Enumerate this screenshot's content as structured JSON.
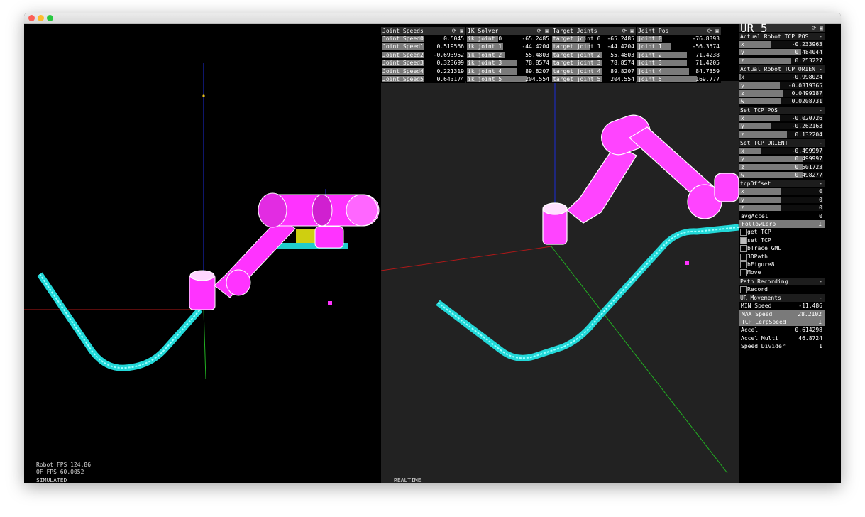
{
  "window": {
    "controls": [
      "close",
      "minimize",
      "zoom"
    ]
  },
  "left_view": {
    "robot_fps": "Robot FPS 124.86",
    "of_fps": "OF FPS 60.0052",
    "mode": "SIMULATED"
  },
  "right_view": {
    "mode": "REALTIME"
  },
  "panels": [
    {
      "title": "Joint Speeds",
      "rows": [
        {
          "label": "Joint Speed0",
          "value": "0.5045",
          "fill": 0.5
        },
        {
          "label": "Joint Speed1",
          "value": "0.519566",
          "fill": 0.5
        },
        {
          "label": "Joint Speed2",
          "value": "-0.693952",
          "fill": 0.5
        },
        {
          "label": "Joint Speed3",
          "value": "0.323699",
          "fill": 0.5
        },
        {
          "label": "Joint Speed4",
          "value": "0.221319",
          "fill": 0.5
        },
        {
          "label": "Joint Speed5",
          "value": "0.643174",
          "fill": 0.5
        }
      ]
    },
    {
      "title": "IK Solver",
      "rows": [
        {
          "label": "ik joint 0",
          "value": "-65.2485",
          "fill": 0.38
        },
        {
          "label": "ik joint 1",
          "value": "-44.4204",
          "fill": 0.44
        },
        {
          "label": "ik joint 2",
          "value": "55.4803",
          "fill": 0.45
        },
        {
          "label": "ik joint 3",
          "value": "78.8574",
          "fill": 0.6
        },
        {
          "label": "ik joint 4",
          "value": "89.8207",
          "fill": 0.6
        },
        {
          "label": "ik joint 5",
          "value": "204.554",
          "fill": 0.72
        }
      ]
    },
    {
      "title": "Target Joints",
      "rows": [
        {
          "label": "target joint 0",
          "value": "-65.2485",
          "fill": 0.4
        },
        {
          "label": "target joint 1",
          "value": "-44.4204",
          "fill": 0.45
        },
        {
          "label": "target joint 2",
          "value": "55.4803",
          "fill": 0.6
        },
        {
          "label": "target joint 3",
          "value": "78.8574",
          "fill": 0.6
        },
        {
          "label": "target joint 4",
          "value": "89.8207",
          "fill": 0.6
        },
        {
          "label": "target joint 5",
          "value": "204.554",
          "fill": 0.6
        }
      ]
    },
    {
      "title": "Joint Pos",
      "rows": [
        {
          "label": "joint 0",
          "value": "-76.8393",
          "fill": 0.3
        },
        {
          "label": "joint 1",
          "value": "-56.3574",
          "fill": 0.4
        },
        {
          "label": "joint 2",
          "value": "71.4238",
          "fill": 0.6
        },
        {
          "label": "joint 3",
          "value": "71.4205",
          "fill": 0.6
        },
        {
          "label": "joint 4",
          "value": "84.7359",
          "fill": 0.62
        },
        {
          "label": "joint 5",
          "value": "169.777",
          "fill": 0.72
        }
      ]
    }
  ],
  "ur5": {
    "title": "UR 5",
    "sections": [
      {
        "title": "Actual Robot TCP POS",
        "rows": [
          {
            "label": "x",
            "value": "-0.233963",
            "fill": 0.38
          },
          {
            "label": "y",
            "value": "0.484044",
            "fill": 0.74
          },
          {
            "label": "z",
            "value": "0.253227",
            "fill": 0.62
          }
        ]
      },
      {
        "title": "Actual Robot TCP ORIENT-",
        "rows": [
          {
            "label": "x",
            "value": "-0.998024",
            "fill": 0.02
          },
          {
            "label": "y",
            "value": "-0.0319365",
            "fill": 0.48
          },
          {
            "label": "z",
            "value": "0.0499187",
            "fill": 0.52
          },
          {
            "label": "w",
            "value": "0.0208731",
            "fill": 0.5
          }
        ]
      },
      {
        "title": "Set TCP POS",
        "rows": [
          {
            "label": "x",
            "value": "-0.020726",
            "fill": 0.48
          },
          {
            "label": "y",
            "value": "-0.262163",
            "fill": 0.37
          },
          {
            "label": "z",
            "value": "0.132204",
            "fill": 0.57
          }
        ]
      },
      {
        "title": "Set TCP ORIENT",
        "rows": [
          {
            "label": "x",
            "value": "-0.499997",
            "fill": 0.25
          },
          {
            "label": "y",
            "value": "0.499997",
            "fill": 0.75
          },
          {
            "label": "z",
            "value": "0.501723",
            "fill": 0.75
          },
          {
            "label": "w",
            "value": "0.498277",
            "fill": 0.75
          }
        ]
      },
      {
        "title": "tcpOffset",
        "rows": [
          {
            "label": "x",
            "value": "0",
            "fill": 0.5
          },
          {
            "label": "y",
            "value": "0",
            "fill": 0.5
          },
          {
            "label": "z",
            "value": "0",
            "fill": 0.5
          }
        ]
      }
    ],
    "avg_accel": {
      "label": "avgAccel",
      "value": "0"
    },
    "follow_lerp": {
      "label": "FollowLerp",
      "value": "1"
    },
    "toggles": [
      {
        "label": "get TCP",
        "checked": false
      },
      {
        "label": "set TCP",
        "checked": true
      },
      {
        "label": "bTrace GML",
        "checked": false
      },
      {
        "label": "3DPath",
        "checked": false
      },
      {
        "label": "bFigure8",
        "checked": false
      },
      {
        "label": "Move",
        "checked": false
      }
    ],
    "path_recording": {
      "title": "Path Recording",
      "record_label": "Record"
    },
    "movements": {
      "title": "UR Movements",
      "rows": [
        {
          "label": "MIN Speed",
          "value": "-11.486"
        },
        {
          "label": "MAX Speed",
          "value": "28.2102"
        },
        {
          "label": "TCP LerpSpeed",
          "value": "1"
        },
        {
          "label": "Accel",
          "value": "0.614298"
        },
        {
          "label": "Accel Multi",
          "value": "46.8724"
        },
        {
          "label": "Speed Divider",
          "value": "1"
        }
      ]
    },
    "collapse_symbol": "-"
  },
  "colors": {
    "robot": "#ff33ff",
    "path": "#33e6e6",
    "x_axis": "#c02020",
    "y_axis": "#20b020",
    "z_axis": "#2030e0"
  }
}
